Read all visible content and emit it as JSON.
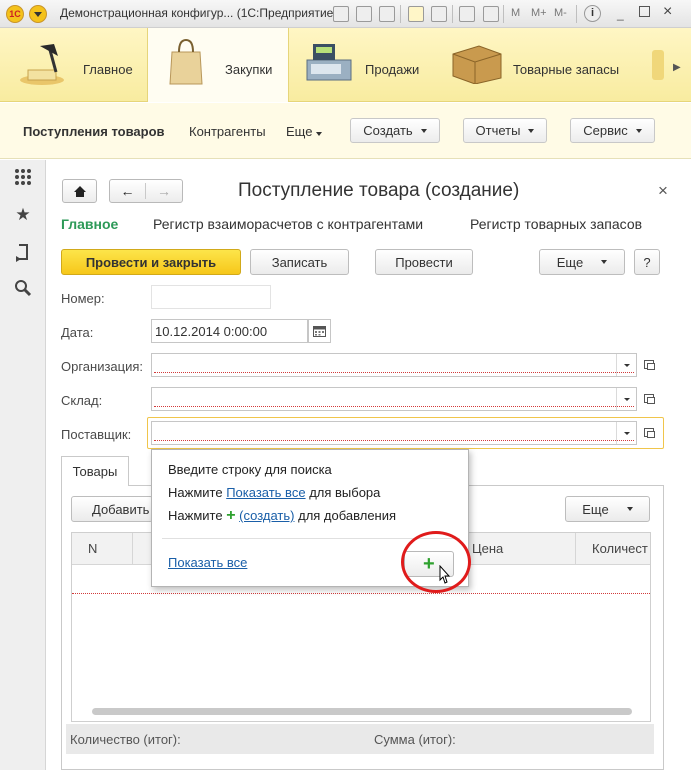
{
  "window": {
    "title": "Демонстрационная конфигур... (1С:Предприятие)",
    "logo_text": "1С",
    "toolbar_text": [
      "M",
      "M+",
      "M-"
    ]
  },
  "sections": [
    {
      "label": "Главное",
      "icon": "desk-lamp-icon"
    },
    {
      "label": "Закупки",
      "icon": "shopping-bag-icon",
      "active": true
    },
    {
      "label": "Продажи",
      "icon": "cash-register-icon"
    },
    {
      "label": "Товарные запасы",
      "icon": "box-icon"
    }
  ],
  "navbar": {
    "current": "Поступления товаров",
    "links": [
      "Контрагенты"
    ],
    "more": "Еще",
    "buttons": [
      "Создать",
      "Отчеты",
      "Сервис"
    ]
  },
  "left_panel": {
    "icons": [
      "grid-icon",
      "star-icon",
      "history-icon",
      "search-icon"
    ]
  },
  "form": {
    "title": "Поступление товара (создание)",
    "close": "×",
    "tabs": [
      "Главное",
      "Регистр взаиморасчетов с контрагентами",
      "Регистр товарных запасов"
    ],
    "commands": {
      "post_close": "Провести и закрыть",
      "save": "Записать",
      "post": "Провести",
      "more": "Еще",
      "help": "?"
    },
    "fields": {
      "number": {
        "label": "Номер:",
        "value": ""
      },
      "date": {
        "label": "Дата:",
        "value": "10.12.2014  0:00:00"
      },
      "organization": {
        "label": "Организация:",
        "value": ""
      },
      "warehouse": {
        "label": "Склад:",
        "value": ""
      },
      "supplier": {
        "label": "Поставщик:",
        "value": ""
      }
    },
    "goods": {
      "tab": "Товары",
      "add": "Добавить",
      "more": "Еще",
      "columns": [
        "N",
        "Цена",
        "Количест"
      ],
      "totals": {
        "quantity": "Количество (итог):",
        "sum": "Сумма (итог):"
      }
    }
  },
  "popup": {
    "line1": "Введите строку для поиска",
    "line2_pre": "Нажмите",
    "line2_link": "Показать все",
    "line2_post": "для выбора",
    "line3_pre": "Нажмите",
    "line3_link": "(создать)",
    "line3_post": "для добавления",
    "show_all": "Показать все"
  }
}
